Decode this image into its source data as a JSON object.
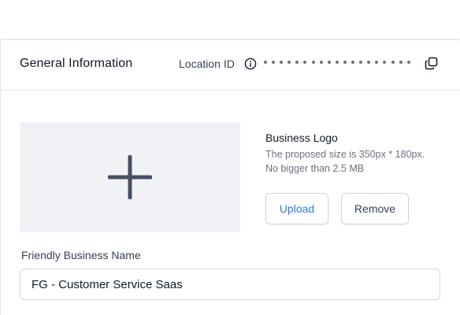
{
  "section": {
    "title": "General Information",
    "location_id_label": "Location ID",
    "location_id_dot_count": 19
  },
  "logo": {
    "title": "Business Logo",
    "hint_line1": "The proposed size is 350px * 180px.",
    "hint_line2": "No bigger than 2.5 MB",
    "upload_label": "Upload",
    "remove_label": "Remove"
  },
  "friendly_name": {
    "label": "Friendly Business Name",
    "value": "FG - Customer Service Saas"
  },
  "icons": {
    "info": "info-icon",
    "copy": "copy-icon",
    "add": "plus-icon"
  },
  "colors": {
    "accent": "#2f7ae5",
    "placeholder_bg": "#f1f2f6",
    "plus": "#475063"
  }
}
